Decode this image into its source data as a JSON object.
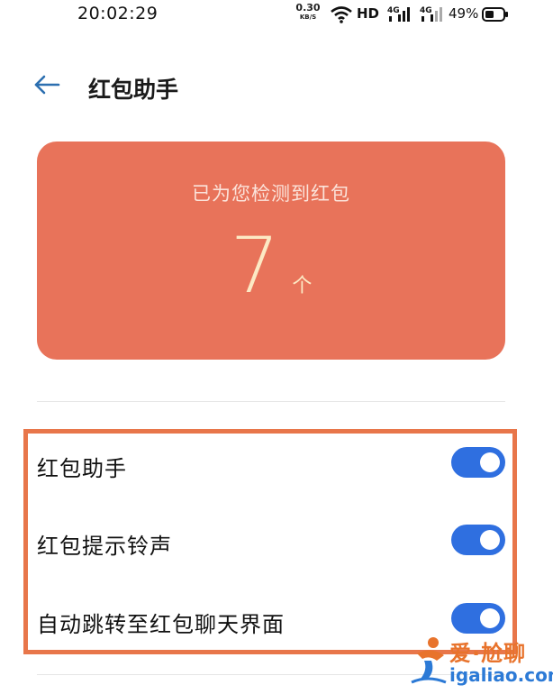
{
  "status_bar": {
    "time": "20:02:29",
    "net_speed_value": "0.30",
    "net_speed_unit": "KB/S",
    "hd_label": "HD",
    "network1": "4G",
    "network2": "4G",
    "battery": "49%"
  },
  "header": {
    "title": "红包助手"
  },
  "card": {
    "label": "已为您检测到红包",
    "count": "7",
    "unit": "个",
    "background": "#e8735a"
  },
  "settings": [
    {
      "label": "红包助手",
      "enabled": true
    },
    {
      "label": "红包提示铃声",
      "enabled": true
    },
    {
      "label": "自动跳转至红包聊天界面",
      "enabled": true
    }
  ],
  "colors": {
    "toggle_on": "#2f6fe0",
    "highlight": "#e8764a",
    "accent_back": "#2c6fb0"
  },
  "watermark": {
    "name": "爱·尬聊",
    "url": "igaliao.com"
  }
}
